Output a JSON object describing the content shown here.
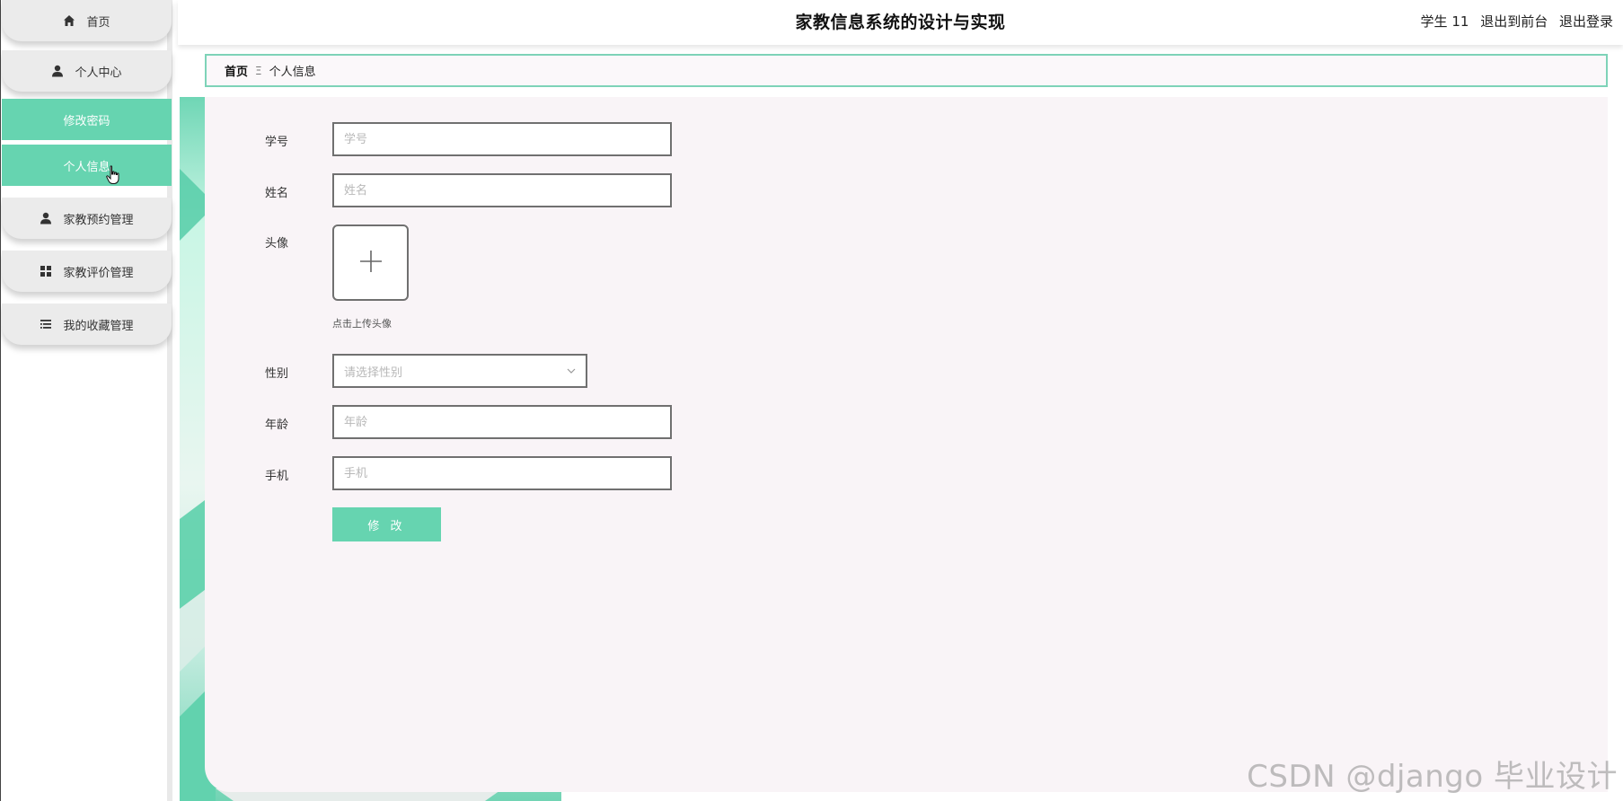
{
  "header": {
    "title": "家教信息系统的设计与实现",
    "user": "学生 11",
    "to_front_label": "退出到前台",
    "logout_label": "退出登录"
  },
  "sidebar": {
    "items": [
      {
        "label": "首页",
        "icon": "home-icon"
      },
      {
        "label": "个人中心",
        "icon": "user-icon"
      },
      {
        "label": "家教预约管理",
        "icon": "user-icon"
      },
      {
        "label": "家教评价管理",
        "icon": "grid-icon"
      },
      {
        "label": "我的收藏管理",
        "icon": "list-icon"
      }
    ],
    "sub_items": [
      {
        "label": "修改密码"
      },
      {
        "label": "个人信息"
      }
    ]
  },
  "breadcrumb": {
    "home": "首页",
    "separator": "Ξ",
    "current": "个人信息"
  },
  "form": {
    "student_id": {
      "label": "学号",
      "placeholder": "学号",
      "value": ""
    },
    "name": {
      "label": "姓名",
      "placeholder": "姓名",
      "value": ""
    },
    "avatar": {
      "label": "头像",
      "hint": "点击上传头像",
      "icon": "plus-icon"
    },
    "gender": {
      "label": "性别",
      "placeholder": "请选择性别"
    },
    "age": {
      "label": "年龄",
      "placeholder": "年龄",
      "value": ""
    },
    "phone": {
      "label": "手机",
      "placeholder": "手机",
      "value": ""
    },
    "submit_label": "修 改"
  },
  "watermark": "CSDN @django 毕业设计",
  "colors": {
    "accent": "#66d4b0",
    "breadcrumb_border": "#7ed3b8",
    "content_bg": "#f9f4f7",
    "menu_bg": "#ebebeb"
  }
}
